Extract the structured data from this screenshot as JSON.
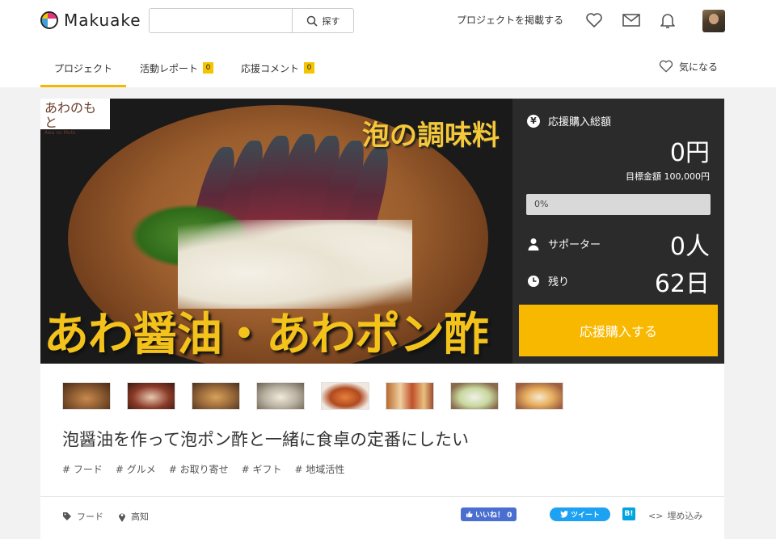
{
  "header": {
    "logo_text": "Makuake",
    "search_placeholder": "",
    "search_button": "探す",
    "post_project": "プロジェクトを掲載する"
  },
  "tabs": [
    {
      "label": "プロジェクト"
    },
    {
      "label": "活動レポート",
      "badge": "0"
    },
    {
      "label": "応援コメント",
      "badge": "0"
    }
  ],
  "favorite_label": "気になる",
  "hero": {
    "brand_logo": "あわのもと",
    "brand_logo_sub": "Awa no Moto",
    "top_text": "泡の調味料",
    "bottom_text": "あわ醤油・あわポン酢"
  },
  "stats": {
    "total_label": "応援購入総額",
    "total_value": "0円",
    "goal": "目標金額 100,000円",
    "progress_text": "0%",
    "progress_fraction": 0,
    "supporters_label": "サポーター",
    "supporters_value": "0人",
    "remaining_label": "残り",
    "remaining_value": "62日",
    "buy_button": "応援購入する"
  },
  "project": {
    "title": "泡醤油を作って泡ポン酢と一緒に食卓の定番にしたい",
    "tags": [
      "# フード",
      "# グルメ",
      "# お取り寄せ",
      "# ギフト",
      "# 地域活性"
    ],
    "category": "フード",
    "location": "高知"
  },
  "share": {
    "like": "いいね！ 0",
    "tweet": "ツイート",
    "hatena": "B!",
    "embed": "埋め込み"
  },
  "colors": {
    "accent": "#f5b800",
    "stats_bg": "#2b2b2b",
    "facebook": "#4a6fd0",
    "twitter": "#1da1f2",
    "hatena": "#00a4de"
  }
}
